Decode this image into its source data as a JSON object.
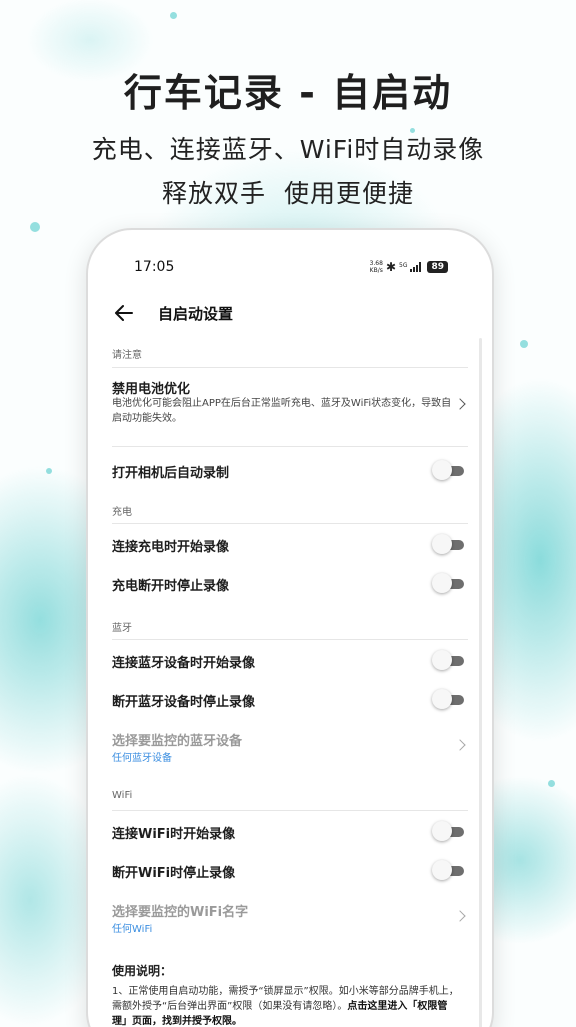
{
  "promo": {
    "title": "行车记录 - 自启动",
    "subtitle_line1": "充电、连接蓝牙、WiFi时自动录像",
    "subtitle_line2": "释放双手  使用更便捷"
  },
  "status_bar": {
    "time": "17:05",
    "net_speed_value": "3.68",
    "net_speed_unit": "KB/s",
    "network": "5G",
    "battery": "89",
    "icons": [
      "bluetooth-icon",
      "signal-icon",
      "battery-icon"
    ]
  },
  "header": {
    "back_icon": "arrow-left-icon",
    "title": "自启动设置"
  },
  "notice": {
    "label": "请注意",
    "battery_title": "禁用电池优化",
    "battery_desc": "电池优化可能会阻止APP在后台正常监听充电、蓝牙及WiFi状态变化，导致自启动功能失效。",
    "camera_title": "打开相机后自动录制",
    "camera_on": false
  },
  "charging": {
    "label": "充电",
    "start_title": "连接充电时开始录像",
    "start_on": false,
    "stop_title": "充电断开时停止录像",
    "stop_on": false
  },
  "bluetooth": {
    "label": "蓝牙",
    "start_title": "连接蓝牙设备时开始录像",
    "start_on": false,
    "stop_title": "断开蓝牙设备时停止录像",
    "stop_on": false,
    "select_title": "选择要监控的蓝牙设备",
    "select_value": "任何蓝牙设备"
  },
  "wifi": {
    "label": "WiFi",
    "start_title": "连接WiFi时开始录像",
    "start_on": false,
    "stop_title": "断开WiFi时停止录像",
    "stop_on": false,
    "select_title": "选择要监控的WiFi名字",
    "select_value": "任何WiFi"
  },
  "usage": {
    "title": "使用说明：",
    "text_plain": "1、正常使用自启动功能，需授予“锁屏显示”权限。如小米等部分品牌手机上，需额外授予“后台弹出界面”权限（如果没有请忽略）。",
    "text_bold": "点击这里进入「权限管理」页面，找到并授予权限。"
  },
  "colors": {
    "accent_blue": "#3b8ee0",
    "splash": "#40c4c4",
    "toggle_track": "#6e6e6e"
  }
}
